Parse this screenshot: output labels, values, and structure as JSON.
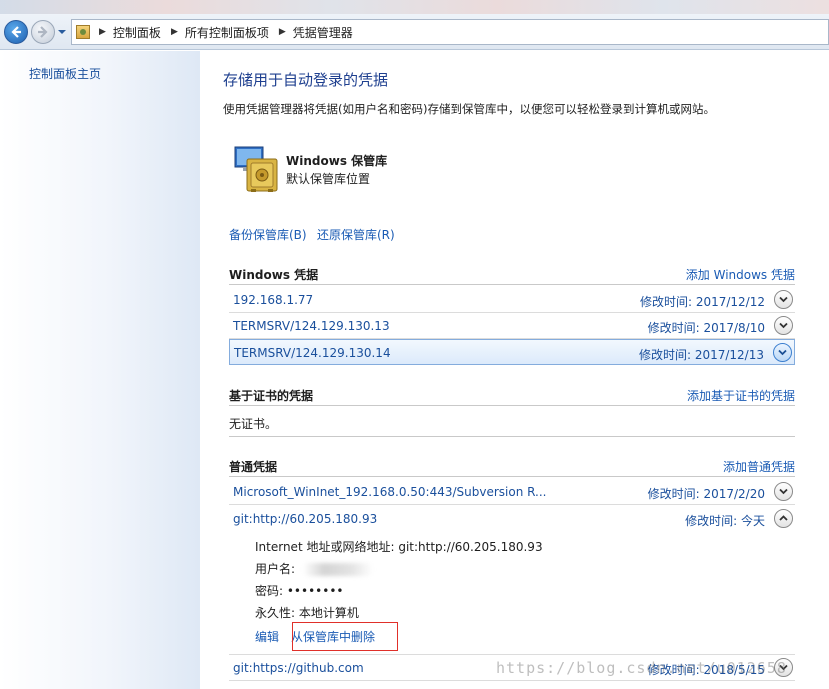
{
  "breadcrumb": [
    "控制面板",
    "所有控制面板项",
    "凭据管理器"
  ],
  "sidebar": {
    "home_link": "控制面板主页"
  },
  "header": {
    "title": "存储用于自动登录的凭据",
    "description": "使用凭据管理器将凭据(如用户名和密码)存储到保管库中，以便您可以轻松登录到计算机或网站。"
  },
  "vault": {
    "name": "Windows 保管库",
    "subtitle": "默认保管库位置"
  },
  "actions": {
    "backup": "备份保管库(B)",
    "restore": "还原保管库(R)"
  },
  "windows_credentials": {
    "title": "Windows 凭据",
    "add_label": "添加 Windows 凭据",
    "items": [
      {
        "name": "192.168.1.77",
        "modified": "修改时间:  2017/12/12"
      },
      {
        "name": "TERMSRV/124.129.130.13",
        "modified": "修改时间:  2017/8/10"
      },
      {
        "name": "TERMSRV/124.129.130.14",
        "modified": "修改时间:  2017/12/13"
      }
    ]
  },
  "cert_credentials": {
    "title": "基于证书的凭据",
    "add_label": "添加基于证书的凭据",
    "empty_text": "无证书。"
  },
  "generic_credentials": {
    "title": "普通凭据",
    "add_label": "添加普通凭据",
    "items": [
      {
        "name": "Microsoft_WinInet_192.168.0.50:443/Subversion R...",
        "modified": "修改时间:  2017/2/20"
      },
      {
        "name": "git:http://60.205.180.93",
        "modified": "修改时间:  今天"
      },
      {
        "name": "git:https://github.com",
        "modified": "修改时间:  2018/5/15"
      }
    ],
    "expanded": {
      "address": "Internet 地址或网络地址:  git:http://60.205.180.93",
      "username_label": "用户名:",
      "password": "密码:  ••••••••",
      "persistence": "永久性:  本地计算机",
      "edit": "编辑",
      "remove": "从保管库中删除"
    }
  },
  "watermark": "https://blog.csdn.net/u012658",
  "colors": {
    "link": "#1a5bb4",
    "title": "#1e3f8f",
    "highlight_border": "#e0302a"
  }
}
